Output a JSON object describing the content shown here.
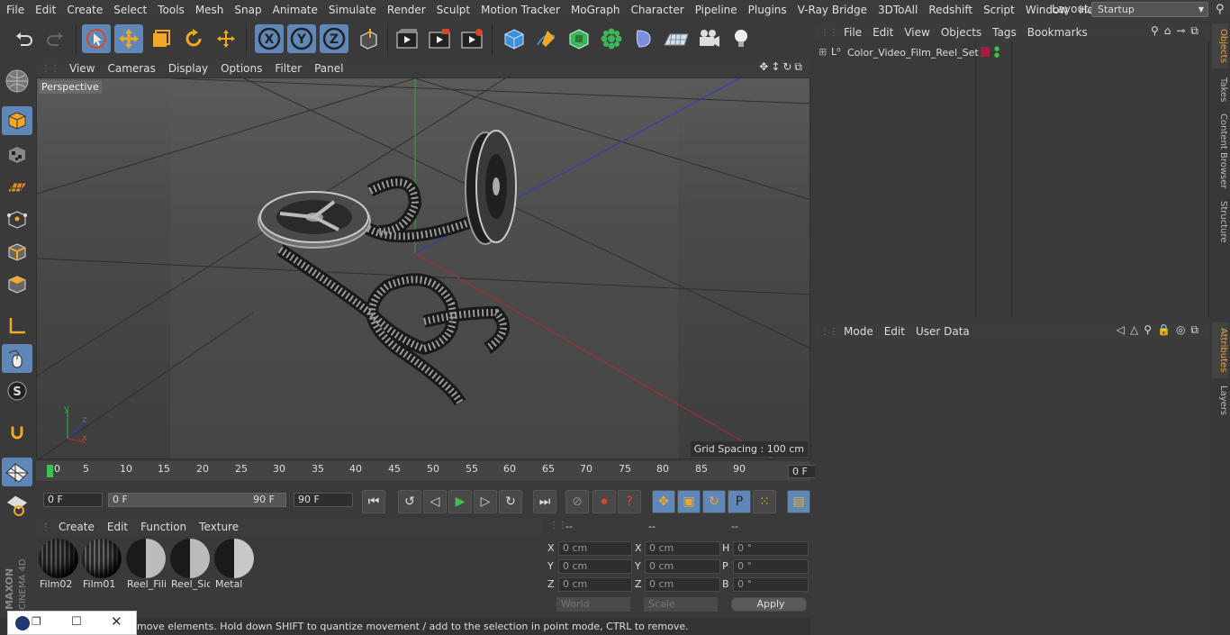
{
  "menubar": {
    "items": [
      "File",
      "Edit",
      "Create",
      "Select",
      "Tools",
      "Mesh",
      "Snap",
      "Animate",
      "Simulate",
      "Render",
      "Sculpt",
      "Motion Tracker",
      "MoGraph",
      "Character",
      "Pipeline",
      "Plugins",
      "V-Ray Bridge",
      "3DToAll",
      "Redshift",
      "Script",
      "Window",
      "Help"
    ],
    "layout_label": "Layout:",
    "layout_value": "Startup"
  },
  "viewport": {
    "menu": [
      "View",
      "Cameras",
      "Display",
      "Options",
      "Filter",
      "Panel"
    ],
    "label": "Perspective",
    "grid_spacing": "Grid Spacing : 100 cm",
    "axis_y": "y",
    "axis_z": "z",
    "axis_x": "x"
  },
  "timeline": {
    "ticks": [
      "0",
      "5",
      "10",
      "15",
      "20",
      "25",
      "30",
      "35",
      "40",
      "45",
      "50",
      "55",
      "60",
      "65",
      "70",
      "75",
      "80",
      "85",
      "90"
    ],
    "frame_value": "0 F"
  },
  "transport": {
    "start_frame": "0 F",
    "range_start": "0 F",
    "range_end": "90 F",
    "end_frame": "90 F"
  },
  "materials": {
    "menu": [
      "Create",
      "Edit",
      "Function",
      "Texture"
    ],
    "items": [
      {
        "label": "Film02",
        "style": "striped"
      },
      {
        "label": "Film01",
        "style": "striped"
      },
      {
        "label": "Reel_Fili",
        "style": "half"
      },
      {
        "label": "Reel_Sic",
        "style": "half"
      },
      {
        "label": "Metal",
        "style": "half"
      }
    ]
  },
  "coordinates": {
    "headers": [
      "--",
      "--",
      "--"
    ],
    "rows": [
      {
        "l1": "X",
        "v1": "0 cm",
        "l2": "X",
        "v2": "0 cm",
        "l3": "H",
        "v3": "0 °"
      },
      {
        "l1": "Y",
        "v1": "0 cm",
        "l2": "Y",
        "v2": "0 cm",
        "l3": "P",
        "v3": "0 °"
      },
      {
        "l1": "Z",
        "v1": "0 cm",
        "l2": "Z",
        "v2": "0 cm",
        "l3": "B",
        "v3": "0 °"
      }
    ],
    "space": "World",
    "mode": "Scale",
    "apply": "Apply"
  },
  "status": {
    "text": "move elements. Hold down SHIFT to quantize movement / add to the selection in point mode, CTRL to remove."
  },
  "objects": {
    "menu": [
      "File",
      "Edit",
      "View",
      "Objects",
      "Tags",
      "Bookmarks"
    ],
    "items": [
      {
        "name": "Color_Video_Film_Reel_Set"
      }
    ]
  },
  "attributes": {
    "menu": [
      "Mode",
      "Edit",
      "User Data"
    ]
  },
  "side_tabs": [
    "Objects",
    "Takes",
    "Content Browser",
    "Structure",
    "Attributes",
    "Layers"
  ],
  "logo": "MAXON CINEMA 4D"
}
